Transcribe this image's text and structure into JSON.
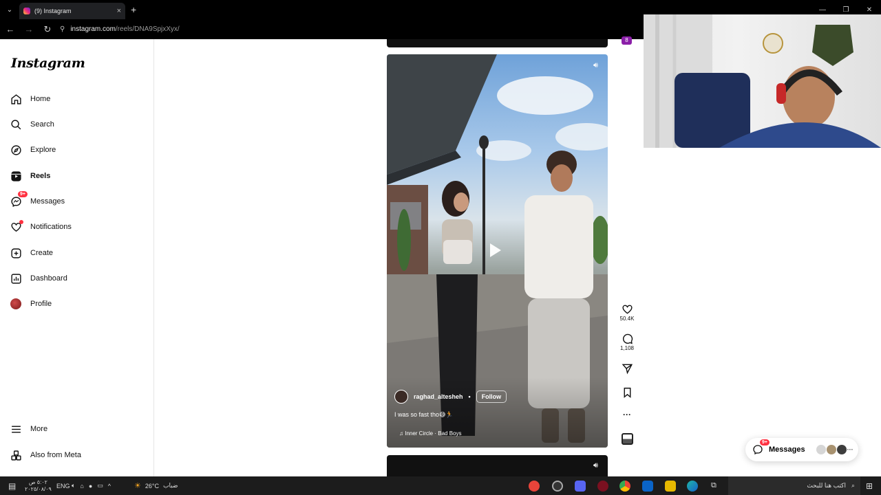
{
  "browser": {
    "tab_title": "(9) Instagram",
    "tab_close": "×",
    "new_tab": "+",
    "url_domain": "instagram.com",
    "url_path": "/reels/DNA9SpjxXyx/"
  },
  "sidebar": {
    "logo": "Instagram",
    "items": [
      {
        "label": "Home"
      },
      {
        "label": "Search"
      },
      {
        "label": "Explore"
      },
      {
        "label": "Reels"
      },
      {
        "label": "Messages",
        "badge": "9+"
      },
      {
        "label": "Notifications"
      },
      {
        "label": "Create"
      },
      {
        "label": "Dashboard"
      },
      {
        "label": "Profile"
      }
    ],
    "more": "More",
    "also_from_meta": "Also from Meta"
  },
  "reel": {
    "username": "raghad_altesheh",
    "separator": "•",
    "follow": "Follow",
    "caption": "I was so fast tho😅🏃",
    "audio": "♫ Inner Circle · Bad Boys",
    "likes": "50.4K",
    "comments": "1,108",
    "prev_badge": "8"
  },
  "messages_pill": {
    "label": "Messages",
    "badge": "9+",
    "more": "···"
  },
  "taskbar": {
    "time": "٥:٠٢ ص",
    "date": "٢٠٢٥/٠٨/٠٩",
    "lang": "ENG",
    "weather_temp": "26°C",
    "weather_desc": "ضباب",
    "search_placeholder": "اكتب هنا للبحث"
  },
  "colors": {
    "accent_red": "#ff3040",
    "taskbar_bg": "#1c1c1c",
    "chrome_bg": "#000000"
  }
}
